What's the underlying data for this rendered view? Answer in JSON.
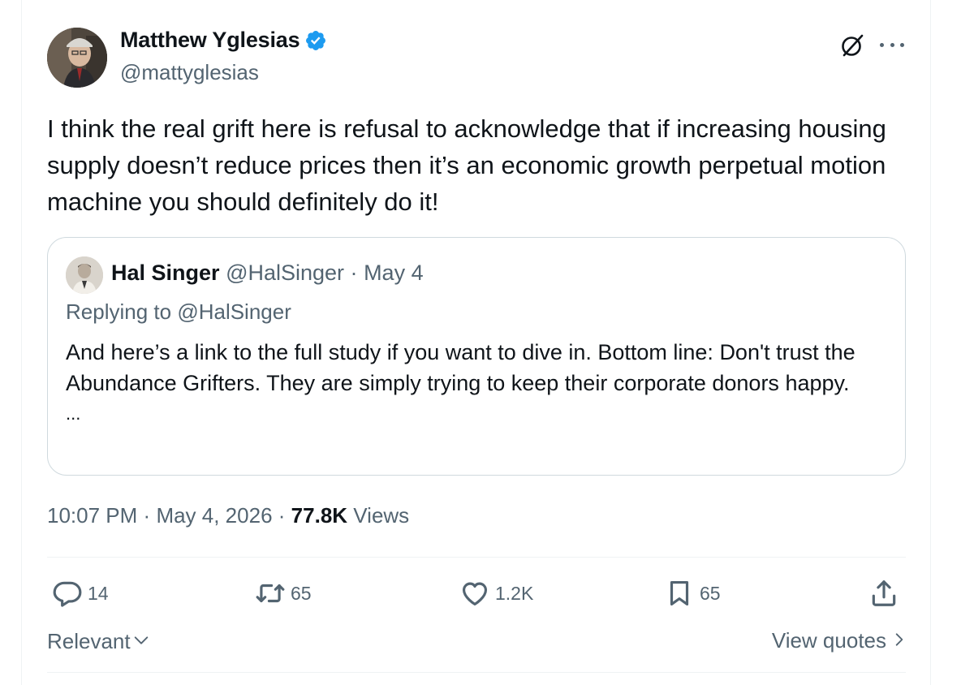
{
  "author": {
    "name": "Matthew Yglesias",
    "handle": "@mattyglesias",
    "verified": true,
    "verified_color": "#1d9bf0"
  },
  "tweet": {
    "text": "I think the real grift here is refusal to acknowledge that if increasing housing supply doesn’t reduce prices then it’s an economic growth perpetual motion machine you should definitely do it!"
  },
  "quote": {
    "name": "Hal Singer",
    "handle": "@HalSinger",
    "date": "May 4",
    "replying_prefix": "Replying to ",
    "replying_handle": "@HalSinger",
    "text": "And here’s a link to the full study if you want to dive in. Bottom line: Don't trust the Abundance Grifters. They are simply trying to keep their corporate donors happy.",
    "ellipsis": "..."
  },
  "meta": {
    "time": "10:07 PM",
    "date": "May 4, 2026",
    "views_count": "77.8K",
    "views_label": "Views",
    "separator": "·"
  },
  "actions": {
    "replies": "14",
    "reposts": "65",
    "likes": "1.2K",
    "bookmarks": "65"
  },
  "footer": {
    "sort_label": "Relevant",
    "view_quotes_label": "View quotes"
  },
  "icons": {
    "grok": "grok-icon",
    "more": "more-icon",
    "reply": "reply-icon",
    "repost": "repost-icon",
    "like": "heart-icon",
    "bookmark": "bookmark-icon",
    "share": "share-icon"
  },
  "colors": {
    "text": "#0f1419",
    "secondary": "#536471",
    "border": "#cfd9de",
    "divider": "#eff3f4"
  }
}
